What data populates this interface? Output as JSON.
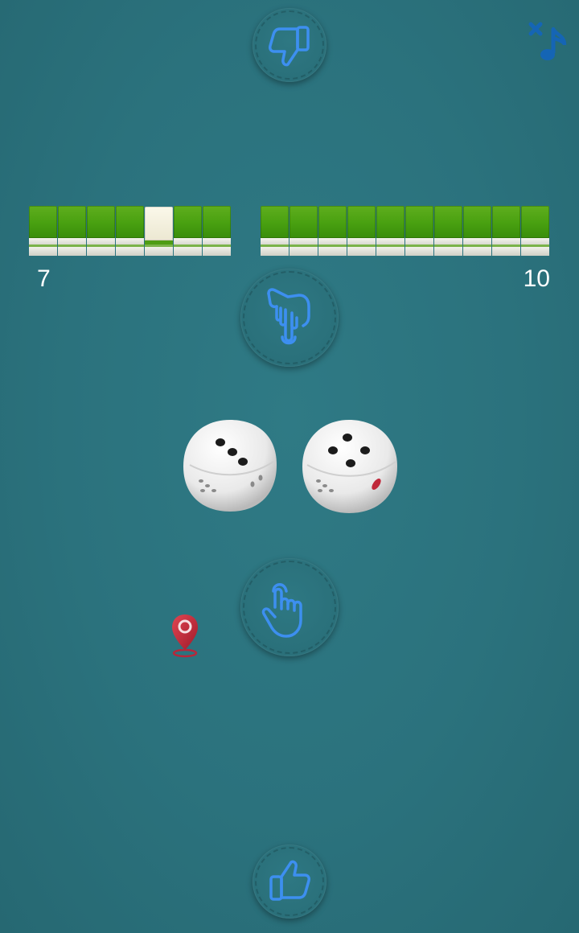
{
  "game": {
    "left_wall": {
      "count": "7",
      "tiles_total": 7,
      "open_tile_index": 4
    },
    "right_wall": {
      "count": "10",
      "tiles_total": 10
    },
    "dice": [
      {
        "top_face": 3
      },
      {
        "top_face": 4
      }
    ]
  },
  "controls": {
    "dislike_icon": "thumbs-down-icon",
    "music_icon": "music-muted-icon",
    "point_down_icon": "hand-point-down-icon",
    "tap_icon": "hand-tap-icon",
    "like_icon": "thumbs-up-icon",
    "marker_icon": "map-pin-icon"
  },
  "colors": {
    "background": "#2b727d",
    "icon_blue": "#3d8ff0",
    "tile_green": "#48a010",
    "pin_red": "#c0283a"
  }
}
